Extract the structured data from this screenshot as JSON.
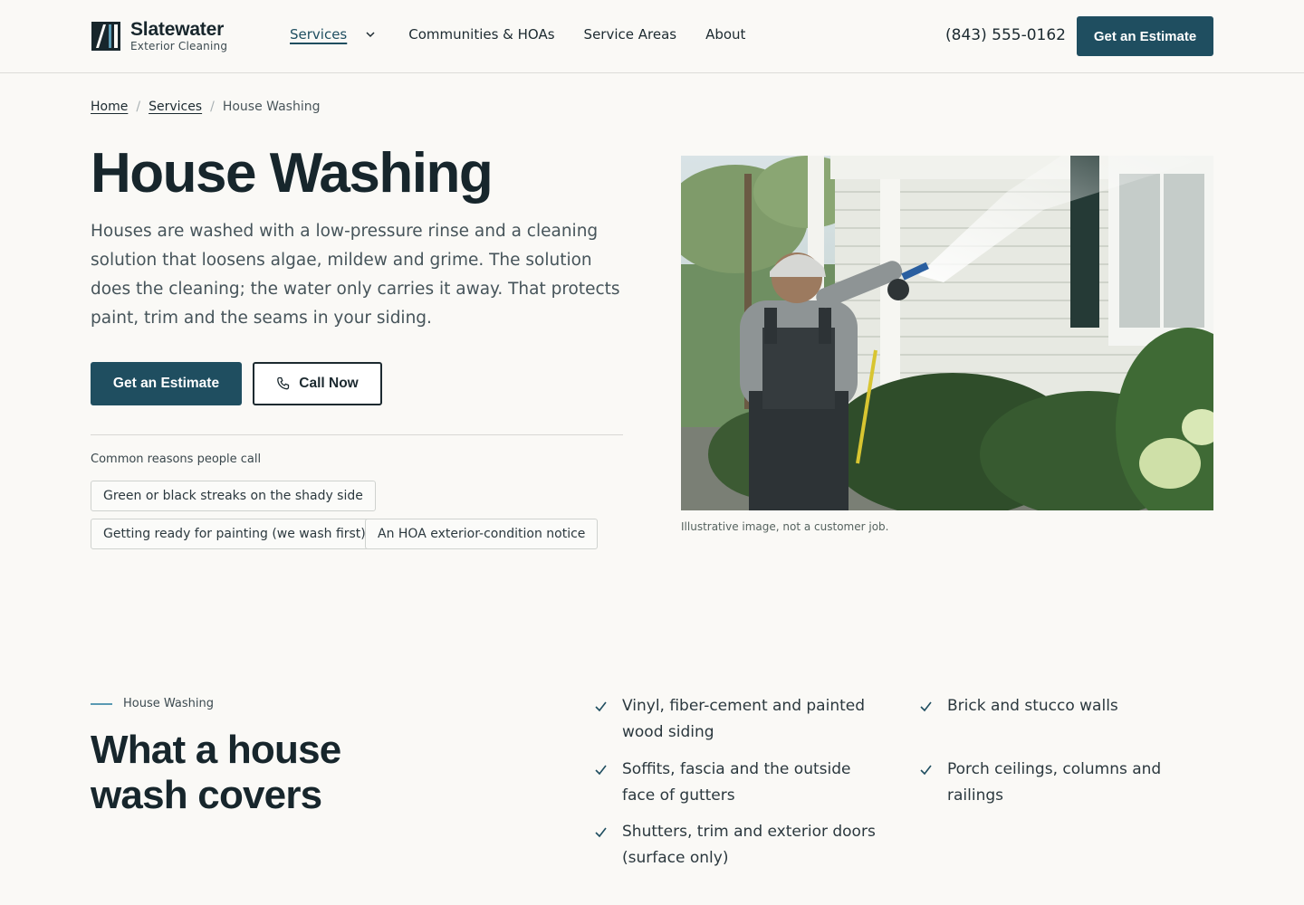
{
  "brand": {
    "name": "Slatewater",
    "tagline": "Exterior Cleaning"
  },
  "nav": {
    "items": [
      {
        "label": "Services"
      },
      {
        "label": "Communities & HOAs"
      },
      {
        "label": "Service Areas"
      },
      {
        "label": "About"
      }
    ],
    "phone": "(843) 555-0162",
    "cta": "Get an Estimate"
  },
  "breadcrumb": {
    "home": "Home",
    "services": "Services",
    "current": "House Washing"
  },
  "hero": {
    "title": "House Washing",
    "description": "Houses are washed with a low-pressure rinse and a cleaning solution that loosens algae, mildew and grime. The solution does the cleaning; the water only carries it away. That protects paint, trim and the seams in your siding.",
    "primary_cta": "Get an Estimate",
    "secondary_cta": "Call Now",
    "reasons_label": "Common reasons people call",
    "reasons": [
      "Green or black streaks on the shady side",
      "Getting ready for painting (we wash first)",
      "An HOA exterior-condition notice"
    ],
    "image_caption": "Illustrative image, not a customer job."
  },
  "coverage": {
    "eyebrow": "House Washing",
    "title": "What a house wash covers",
    "items": [
      "Vinyl, fiber-cement and painted wood siding",
      "Soffits, fascia and the outside face of gutters",
      "Shutters, trim and exterior doors (surface only)",
      "Brick and stucco walls",
      "Porch ceilings, columns and railings"
    ]
  },
  "colors": {
    "primary": "#1f4e60",
    "background": "#faf9f6",
    "text": "#17262c",
    "accent_line": "#5a9ab3"
  },
  "icons": [
    "logo-mark-icon",
    "chevron-down-icon",
    "phone-icon",
    "check-icon"
  ]
}
